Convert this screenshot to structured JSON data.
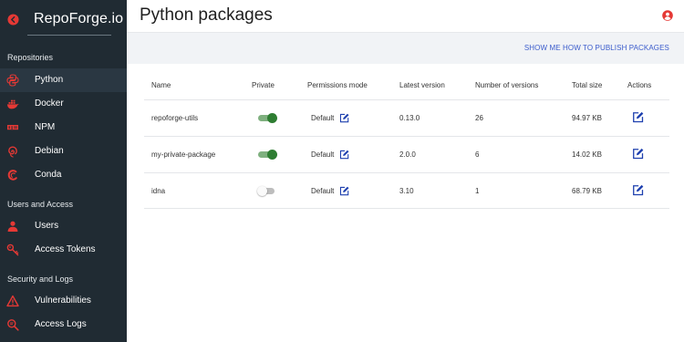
{
  "brand": {
    "name": "RepoForge.io",
    "back_icon": "circle-chevron-left-icon"
  },
  "sidebar": {
    "sections": [
      {
        "title": "Repositories"
      },
      {
        "title": "Users and Access"
      },
      {
        "title": "Security and Logs"
      }
    ],
    "items": [
      {
        "label": "Python",
        "icon": "python-icon",
        "active": true
      },
      {
        "label": "Docker",
        "icon": "docker-icon"
      },
      {
        "label": "NPM",
        "icon": "npm-icon"
      },
      {
        "label": "Debian",
        "icon": "debian-icon"
      },
      {
        "label": "Conda",
        "icon": "conda-icon"
      },
      {
        "label": "Users",
        "icon": "users-icon"
      },
      {
        "label": "Access Tokens",
        "icon": "key-icon"
      },
      {
        "label": "Vulnerabilities",
        "icon": "warning-icon"
      },
      {
        "label": "Access Logs",
        "icon": "logs-icon"
      }
    ]
  },
  "header": {
    "title": "Python packages",
    "avatar_icon": "user-avatar-icon"
  },
  "subbar": {
    "link": "SHOW ME HOW TO PUBLISH PACKAGES"
  },
  "table": {
    "columns": [
      "Name",
      "Private",
      "Permissions mode",
      "Latest version",
      "Number of versions",
      "Total size",
      "Actions"
    ],
    "rows": [
      {
        "name": "repoforge-utils",
        "private": true,
        "permissions": "Default",
        "latest": "0.13.0",
        "versions": "26",
        "size": "94.97 KB"
      },
      {
        "name": "my-private-package",
        "private": true,
        "permissions": "Default",
        "latest": "2.0.0",
        "versions": "6",
        "size": "14.02 KB"
      },
      {
        "name": "idna",
        "private": false,
        "permissions": "Default",
        "latest": "3.10",
        "versions": "1",
        "size": "68.79 KB"
      }
    ]
  },
  "colors": {
    "sidebar_bg": "#202b33",
    "accent_red": "#e53935",
    "link_blue": "#3b5ccc",
    "toggle_on": "#2e7d32",
    "edit_blue": "#1e40af"
  }
}
